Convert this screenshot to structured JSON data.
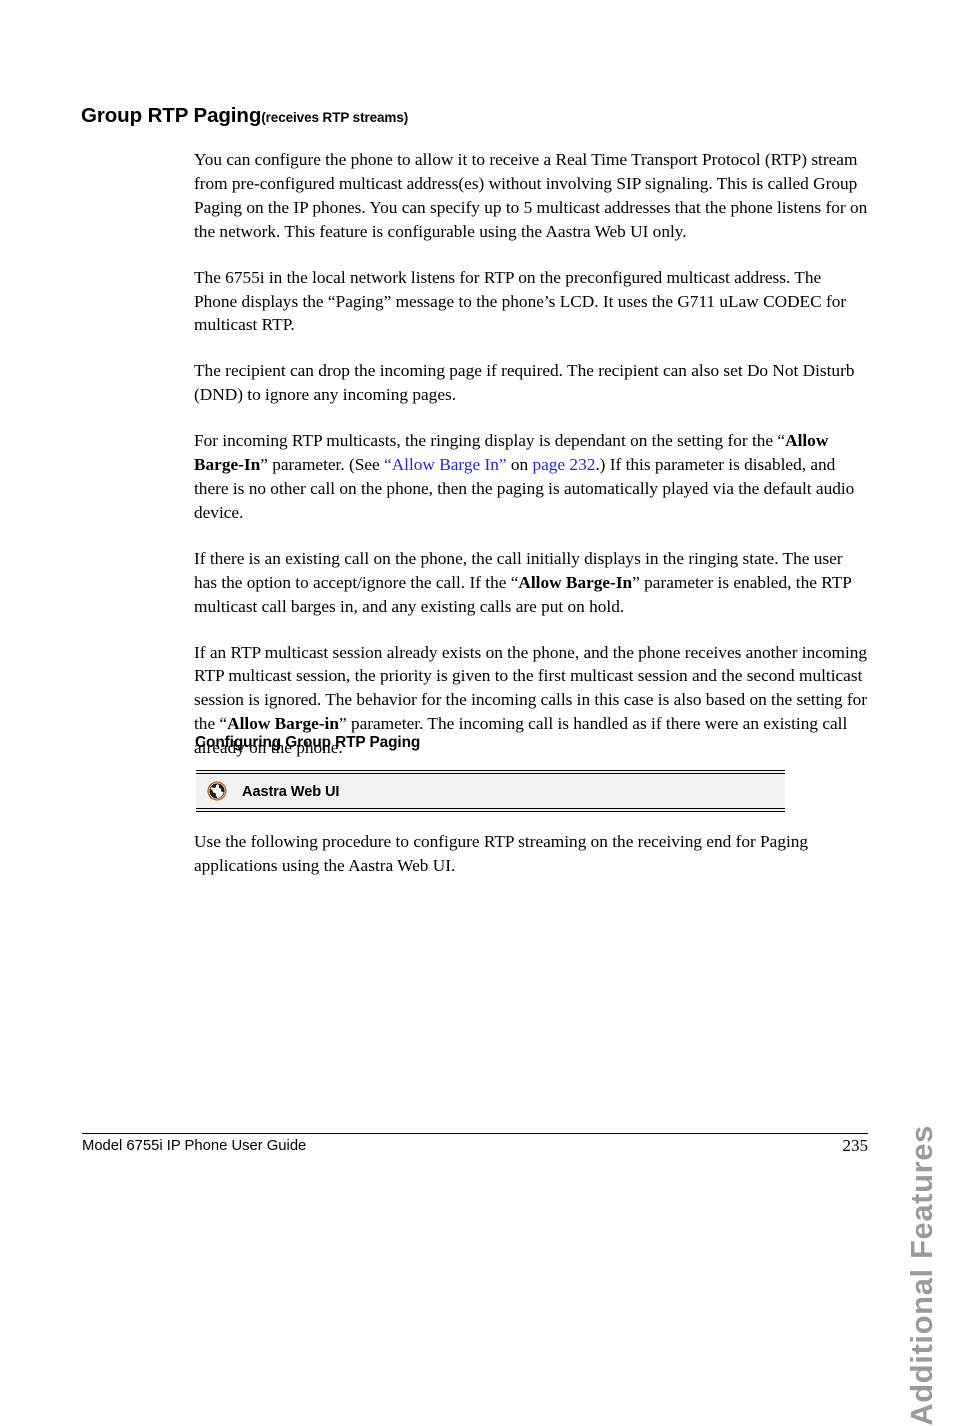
{
  "page": {
    "chapter_tab": "Additional Features",
    "heading_main": "Group RTP Paging",
    "heading_sub": "(receives RTP streams)",
    "sub_heading": "Configuring Group RTP Paging",
    "link_color": "#2727d6",
    "tab_color": "#9b9b9b",
    "callout_bg": "#f2f2f2"
  },
  "paragraphs": {
    "p1": "You can configure the phone to allow it to receive a Real Time Transport Protocol (RTP) stream from pre-configured multicast address(es) without involving SIP signaling. This is called Group Paging on the IP phones. You can specify up to 5 multicast addresses that the phone listens for on the network. This feature is configurable using the Aastra Web UI only.",
    "p2": "The 6755i in the local network listens for RTP on the preconfigured multicast address. The Phone displays the “Paging” message to the phone’s LCD. It uses the G711 uLaw CODEC for multicast RTP.",
    "p3": "The recipient can drop the incoming page if required. The recipient can also set Do Not Disturb (DND) to ignore any incoming pages.",
    "p4_a": "For incoming RTP multicasts, the ringing display is dependant on the setting for the “",
    "p4_bold": "Allow Barge-In",
    "p4_b": "” parameter. (See ",
    "p4_link1": "“Allow Barge In”",
    "p4_c": " on ",
    "p4_link2": "page 232",
    "p4_d": ".) If this parameter is disabled, and there is no other call on the phone, then the paging is automatically played via the default audio device.",
    "p5_a": "If there is an existing call on the phone, the call initially displays in the ringing state. The user has the option to accept/ignore the call. If the “",
    "p5_bold": "Allow Barge-In",
    "p5_b": "” parameter is enabled, the RTP multicast call barges in, and any existing calls are put on hold.",
    "p6_a": "If an RTP multicast session already exists on the phone, and the phone receives another incoming RTP multicast session, the priority is given to the first multicast session and the second multicast session is ignored. The behavior for the incoming calls in this case is also based on the setting for the “",
    "p6_bold": "Allow Barge-in",
    "p6_b": "” parameter. The incoming call is handled as if there were an existing call already on the phone.",
    "p7": "Use the following procedure to configure RTP streaming on the receiving end for Paging applications using the Aastra Web UI."
  },
  "callout": {
    "icon": "globe-icon",
    "label": "Aastra Web UI"
  },
  "footer": {
    "guide_title": "Model 6755i IP Phone User Guide",
    "page_number": "235"
  }
}
